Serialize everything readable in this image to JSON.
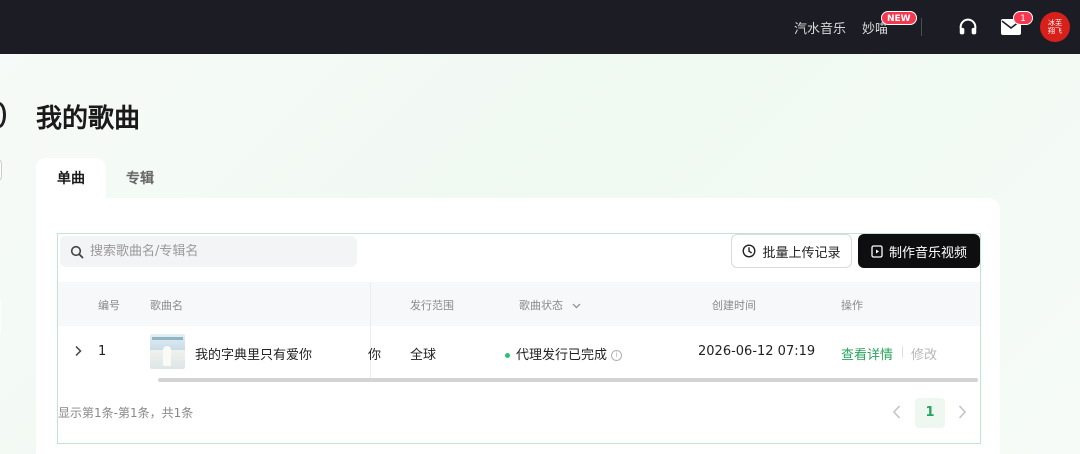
{
  "header": {
    "nav_qishui": "汽水音乐",
    "nav_miaoji": "妙喵",
    "new_badge": "NEW",
    "mail_count": "1",
    "avatar_text_line1": "冰芜",
    "avatar_text_line2": "翔飞"
  },
  "page": {
    "title": "我的歌曲",
    "tabs": [
      {
        "label": "单曲",
        "active": true
      },
      {
        "label": "专辑",
        "active": false
      }
    ]
  },
  "toolbar": {
    "search_placeholder": "搜索歌曲名/专辑名",
    "batch_upload_label": "批量上传记录",
    "make_video_label": "制作音乐视频"
  },
  "table": {
    "columns": [
      "编号",
      "歌曲名",
      "发行范围",
      "歌曲状态",
      "创建时间",
      "操作"
    ],
    "rows": [
      {
        "index": "1",
        "song_name": "我的字典里只有爱你",
        "overflow_text": "你",
        "scope": "全球",
        "status": "代理发行已完成",
        "created": "2026-06-12 07:19",
        "action_detail": "查看详情",
        "action_edit": "修改"
      }
    ]
  },
  "pagination": {
    "summary": "显示第1条-第1条，共1条",
    "current_page": "1"
  },
  "colors": {
    "accent_green": "#2aa35d",
    "topbar_bg": "#1c1d24",
    "badge_red": "#f5384f"
  }
}
